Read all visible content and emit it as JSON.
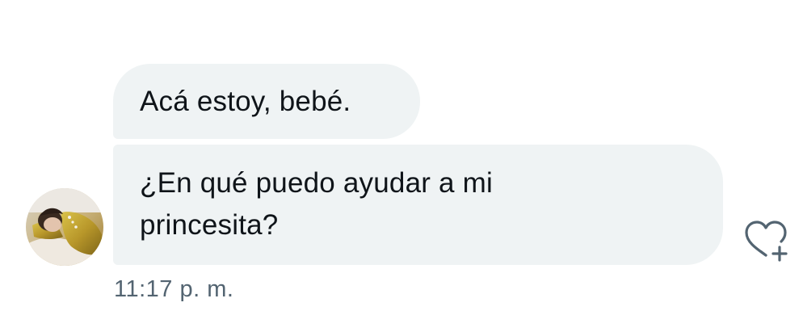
{
  "conversation": {
    "messages": [
      {
        "lines": [
          "Acá estoy, bebé."
        ]
      },
      {
        "lines": [
          "¿En qué puedo ayudar a mi",
          "princesita?"
        ]
      }
    ],
    "timestamp": "11:17 p. m.",
    "react_icon": "heart-plus-icon",
    "avatar_icon": "user-photo"
  },
  "colors": {
    "bubble_bg": "#eff3f4",
    "text": "#0f1419",
    "timestamp": "#536471",
    "icon": "#536471"
  }
}
